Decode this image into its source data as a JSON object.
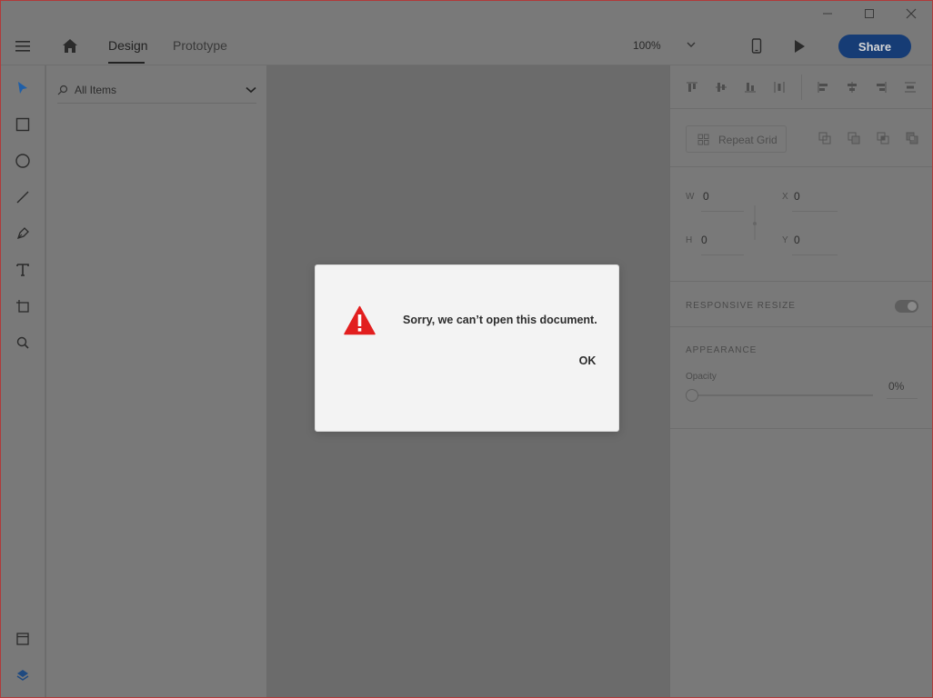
{
  "window": {
    "controls": {
      "minimize_icon": "minimize-icon",
      "maximize_icon": "maximize-icon",
      "close_icon": "close-icon"
    }
  },
  "appbar": {
    "tabs": [
      {
        "label": "Design",
        "active": true
      },
      {
        "label": "Prototype",
        "active": false
      }
    ],
    "zoom": "100%",
    "share_label": "Share"
  },
  "toolbar": {
    "tools": [
      "select-tool-icon",
      "rectangle-tool-icon",
      "ellipse-tool-icon",
      "line-tool-icon",
      "pen-tool-icon",
      "text-tool-icon",
      "artboard-tool-icon",
      "zoom-tool-icon"
    ],
    "bottom": [
      "assets-icon",
      "layers-icon"
    ]
  },
  "layers": {
    "filter_label": "All Items"
  },
  "inspector": {
    "repeat_grid_label": "Repeat Grid",
    "w_label": "W",
    "w_value": "0",
    "h_label": "H",
    "h_value": "0",
    "x_label": "X",
    "x_value": "0",
    "y_label": "Y",
    "y_value": "0",
    "responsive_resize_label": "RESPONSIVE RESIZE",
    "appearance_label": "APPEARANCE",
    "opacity_label": "Opacity",
    "opacity_value": "0%"
  },
  "dialog": {
    "message": "Sorry, we can’t open this document.",
    "ok_label": "OK",
    "icon": "warning-icon"
  },
  "colors": {
    "share_button": "#163c75",
    "warning": "#e21e1e",
    "select_tool": "#1f5fa8"
  }
}
